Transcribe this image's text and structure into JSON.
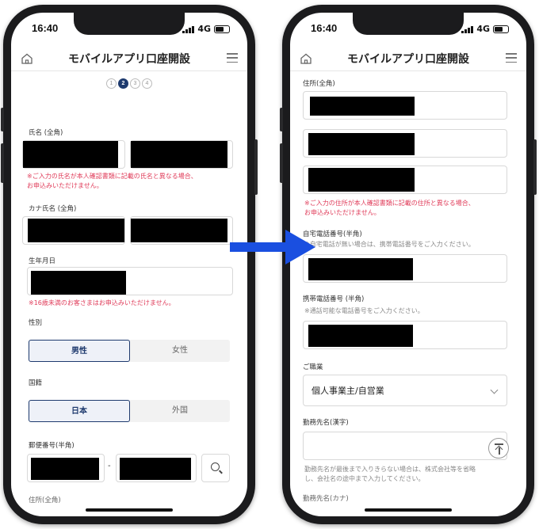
{
  "status_bar": {
    "time": "16:40",
    "network": "4G"
  },
  "header": {
    "title": "モバイルアプリ口座開設"
  },
  "left_screen": {
    "steps": [
      "1",
      "2",
      "3",
      "4"
    ],
    "active_step": 2,
    "name_label": "氏名 (全角)",
    "name_warning_line1": "※ご入力の氏名が本人確認書類に記載の氏名と異なる場合、",
    "name_warning_line2": "お申込みいただけません。",
    "kana_label": "カナ氏名 (全角)",
    "birth_label": "生年月日",
    "birth_warning": "※16歳未満のお客さまはお申込みいただけません。",
    "gender_label": "性別",
    "gender_options": [
      "男性",
      "女性"
    ],
    "gender_selected": "男性",
    "nationality_label": "国籍",
    "nationality_options": [
      "日本",
      "外国"
    ],
    "nationality_selected": "日本",
    "postal_label": "郵便番号(半角)",
    "postal_separator": "-",
    "address_label_partial": "住所(全角)"
  },
  "right_screen": {
    "address_label": "住所(全角)",
    "address_warning_line1": "※ご入力の住所が本人確認書類に記載の住所と異なる場合、",
    "address_warning_line2": "お申込みいただけません。",
    "home_phone_label": "自宅電話番号(半角)",
    "home_phone_hint": "※自宅電話が無い場合は、携帯電話番号をご入力ください。",
    "mobile_label": "携帯電話番号 (半角)",
    "mobile_hint": "※通話可能な電話番号をご入力ください。",
    "occupation_label": "ご職業",
    "occupation_value": "個人事業主/自営業",
    "employer_label": "勤務先名(漢字)",
    "employer_hint_line1": "勤務先名が最後まで入りきらない場合は、株式会社等を省略",
    "employer_hint_line2": "し、会社名の途中まで入力してください。",
    "employer_kana_label_partial": "勤務先名(カナ)"
  },
  "colors": {
    "accent": "#1e3a6e",
    "warning": "#e03c5a",
    "arrow": "#1a4fe0"
  },
  "icons": [
    "home-icon",
    "menu-icon",
    "search-icon",
    "scroll-to-top-icon",
    "chevron-down-icon",
    "arrow-right-icon"
  ]
}
